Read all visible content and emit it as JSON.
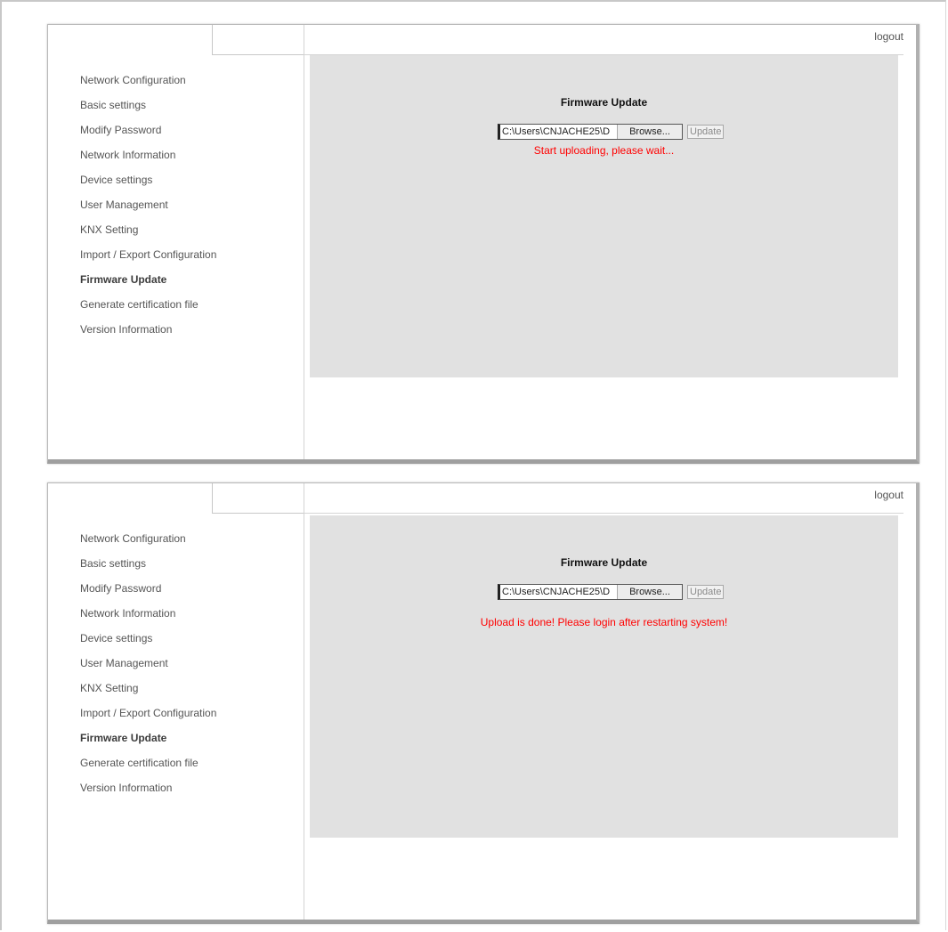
{
  "header": {
    "logout_label": "logout"
  },
  "sidebar": {
    "items": [
      "Network Configuration",
      "Basic settings",
      "Modify Password",
      "Network Information",
      "Device settings",
      "User Management",
      "KNX Setting",
      "Import / Export Configuration",
      "Firmware Update",
      "Generate certification file",
      "Version Information"
    ],
    "active": "Firmware Update"
  },
  "firmware": {
    "title": "Firmware Update",
    "file_path": "C:\\Users\\CNJACHE25\\D",
    "browse_label": "Browse...",
    "update_label": "Update"
  },
  "screens": [
    {
      "status": "Start uploading, please wait..."
    },
    {
      "status": "Upload is done! Please login after restarting system!"
    }
  ],
  "colors": {
    "status_text": "#ff0000",
    "content_bg": "#e1e1e1"
  }
}
